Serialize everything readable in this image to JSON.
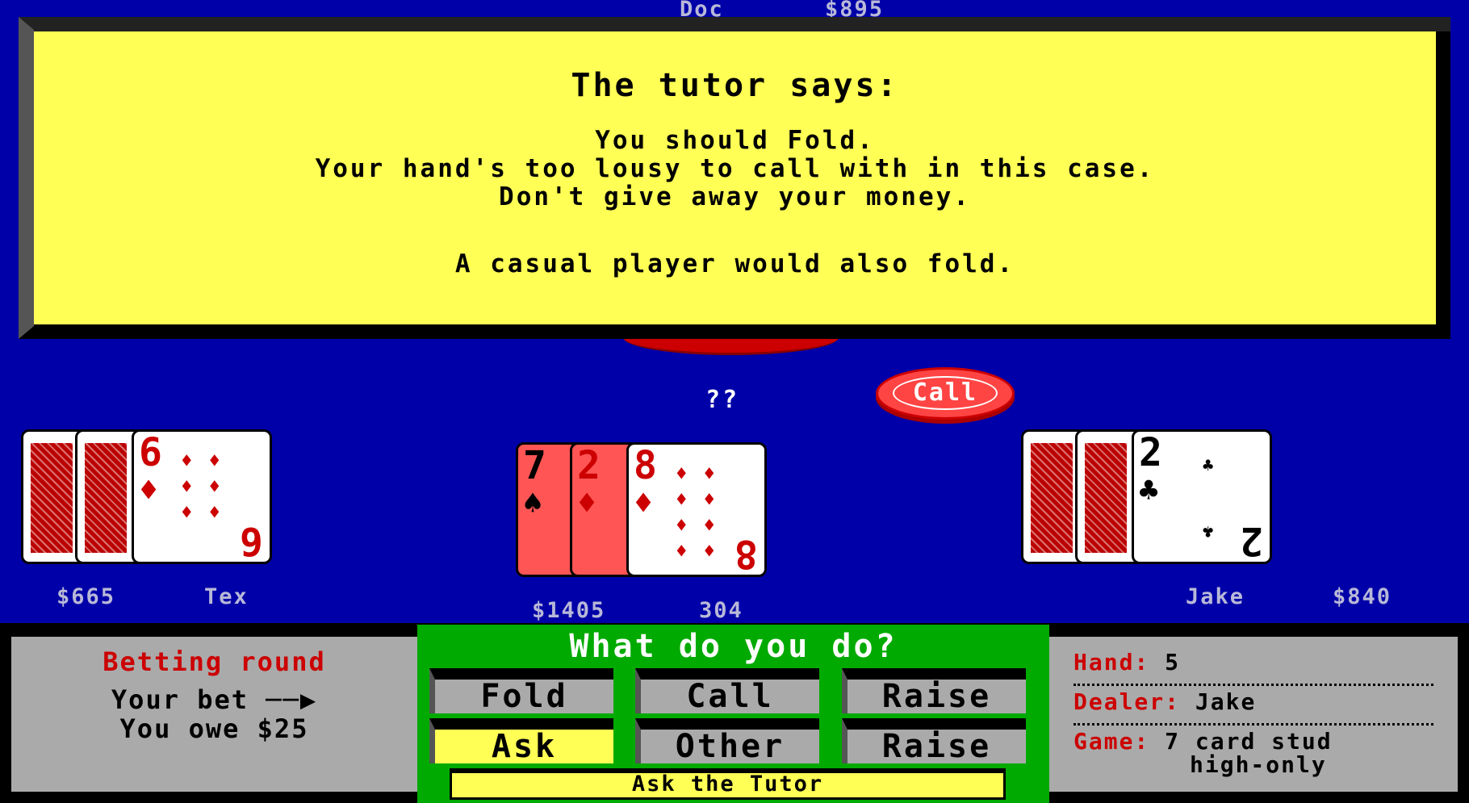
{
  "top_player": {
    "name": "Doc",
    "money": "$895"
  },
  "tutor": {
    "title": "The tutor says:",
    "lines": [
      "You should Fold.",
      "Your hand's too lousy to call with in this case.",
      "Don't give away your money."
    ],
    "footer": "A casual player would also fold."
  },
  "pending": "??",
  "call_chip": "Call",
  "players": {
    "tex": {
      "name": "Tex",
      "money": "$665",
      "cards": [
        {
          "face_down": true
        },
        {
          "face_down": true
        },
        {
          "rank": "6",
          "suit": "♦"
        }
      ]
    },
    "you": {
      "money": "$1405",
      "label": "304",
      "cards": [
        {
          "rank": "7",
          "suit": "♠",
          "highlighted": true
        },
        {
          "rank": "2",
          "suit": "♦",
          "highlighted": true
        },
        {
          "rank": "8",
          "suit": "♦"
        }
      ]
    },
    "jake": {
      "name": "Jake",
      "money": "$840",
      "cards": [
        {
          "face_down": true
        },
        {
          "face_down": true
        },
        {
          "rank": "2",
          "suit": "♣"
        }
      ]
    }
  },
  "status": {
    "round": "Betting round",
    "your_bet": "Your bet",
    "you_owe": "You owe $25"
  },
  "actions": {
    "prompt": "What do you do?",
    "buttons": [
      "Fold",
      "Call",
      "Raise",
      "Ask",
      "Other",
      "Raise"
    ],
    "selected": "Ask",
    "tutor_hint": "Ask the Tutor"
  },
  "info": {
    "hand_label": "Hand:",
    "hand": "5",
    "dealer_label": "Dealer:",
    "dealer": "Jake",
    "game_label": "Game:",
    "game": "7 card stud",
    "game2": "high-only"
  },
  "colors": {
    "table": "#0000a8",
    "tutor_bg": "#ffff55",
    "panel": "#aaaaaa",
    "action_bg": "#00aa00",
    "red": "#cc0000"
  }
}
